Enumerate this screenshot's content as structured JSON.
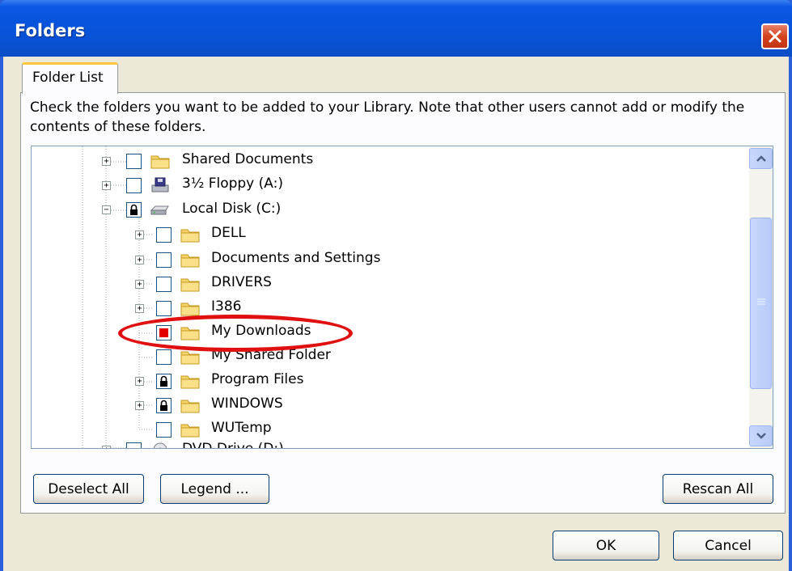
{
  "window": {
    "title": "Folders"
  },
  "tabs": [
    {
      "label": "Folder List"
    }
  ],
  "description": "Check the folders you want to be added to your Library. Note that other users cannot add or modify the contents of these folders.",
  "tree": {
    "items": [
      {
        "label": "Shared Documents",
        "icon": "folder-icon",
        "expander": "+",
        "check": "unchecked"
      },
      {
        "label": "3½ Floppy (A:)",
        "icon": "floppy-drive-icon",
        "expander": "+",
        "check": "unchecked"
      },
      {
        "label": "Local Disk (C:)",
        "icon": "hard-disk-icon",
        "expander": "-",
        "check": "locked"
      },
      {
        "label": "DELL",
        "icon": "folder-icon",
        "expander": "+",
        "check": "unchecked"
      },
      {
        "label": "Documents and Settings",
        "icon": "folder-icon",
        "expander": "+",
        "check": "unchecked"
      },
      {
        "label": "DRIVERS",
        "icon": "folder-icon",
        "expander": "+",
        "check": "unchecked"
      },
      {
        "label": "I386",
        "icon": "folder-icon",
        "expander": "+",
        "check": "unchecked"
      },
      {
        "label": "My Downloads",
        "icon": "folder-icon",
        "expander": "",
        "check": "checked"
      },
      {
        "label": "My Shared Folder",
        "icon": "folder-icon",
        "expander": "",
        "check": "unchecked"
      },
      {
        "label": "Program Files",
        "icon": "folder-icon",
        "expander": "+",
        "check": "locked"
      },
      {
        "label": "WINDOWS",
        "icon": "folder-icon",
        "expander": "+",
        "check": "locked"
      },
      {
        "label": "WUTemp",
        "icon": "folder-icon",
        "expander": "",
        "check": "unchecked"
      },
      {
        "label": "DVD Drive (D:)",
        "icon": "dvd-drive-icon",
        "expander": "+",
        "check": "unchecked"
      }
    ]
  },
  "buttons": {
    "deselect_all": "Deselect All",
    "legend": "Legend ...",
    "rescan_all": "Rescan All",
    "ok": "OK",
    "cancel": "Cancel"
  },
  "colors": {
    "titlebar": "#0752d8",
    "dialog_bg": "#ece9d8",
    "highlight_annotation": "#e01010",
    "checked_fill": "#e30000"
  }
}
